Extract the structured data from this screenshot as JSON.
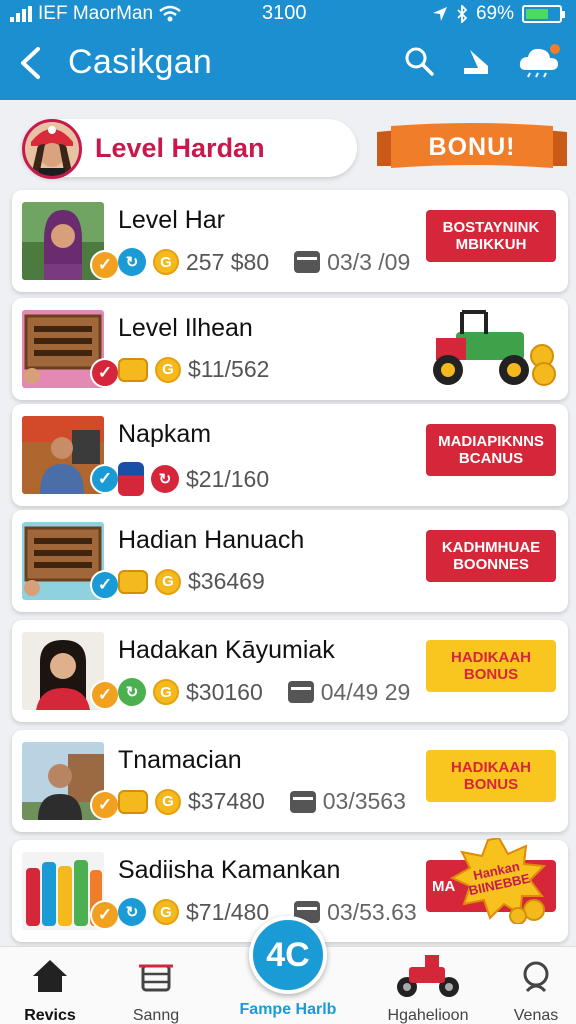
{
  "status_bar": {
    "carrier": "IEF MaorMan",
    "time": "3100",
    "battery": "69%",
    "battery_level": 0.69
  },
  "app_bar": {
    "title": "Casikgan"
  },
  "profile": {
    "name": "Level Hardan",
    "bonus_label": "BONU!"
  },
  "cards": [
    {
      "title": "Level Har",
      "amount": "257 $80",
      "date": "03/3 /09",
      "button": "BOSTAYNINK MBIKKUH",
      "button_style": "red"
    },
    {
      "title": "Level Ilhean",
      "amount": "$11/562"
    },
    {
      "title": "Napkam",
      "amount": "$21/160",
      "button": "MADIAPIKNNS BCANUS",
      "button_style": "red"
    },
    {
      "title": "Hadian Hanuach",
      "amount": "$36469",
      "button": "KADHMHUAE BOONNES",
      "button_style": "red"
    },
    {
      "title": "Hadakan Kāyumiak",
      "amount": "$30160",
      "date": "04/49 29",
      "button": "HADIKAAH BONUS",
      "button_style": "yellow"
    },
    {
      "title": "Tnamacian",
      "amount": "$37480",
      "date": "03/3563",
      "button": "HADIKAAH BONUS",
      "button_style": "yellow"
    },
    {
      "title": "Sadiisha Kamankan",
      "amount": "$71/480",
      "date": "03/53.63",
      "button": "MA",
      "burst_text": "Hankan BIINEBBE"
    }
  ],
  "bottom_nav": {
    "items": [
      {
        "label": "Revics",
        "icon": "home-icon"
      },
      {
        "label": "Sanng",
        "icon": "basket-icon"
      },
      {
        "label": "Hgahelioon",
        "icon": "vehicle-icon"
      },
      {
        "label": "Venas",
        "icon": "search-icon"
      }
    ],
    "center_value": "4C",
    "center_label": "Fampe Harlb"
  },
  "colors": {
    "primary": "#1b8fd0",
    "accent_red": "#d6263a",
    "accent_yellow": "#f9c51f",
    "orange": "#f07d2a"
  }
}
